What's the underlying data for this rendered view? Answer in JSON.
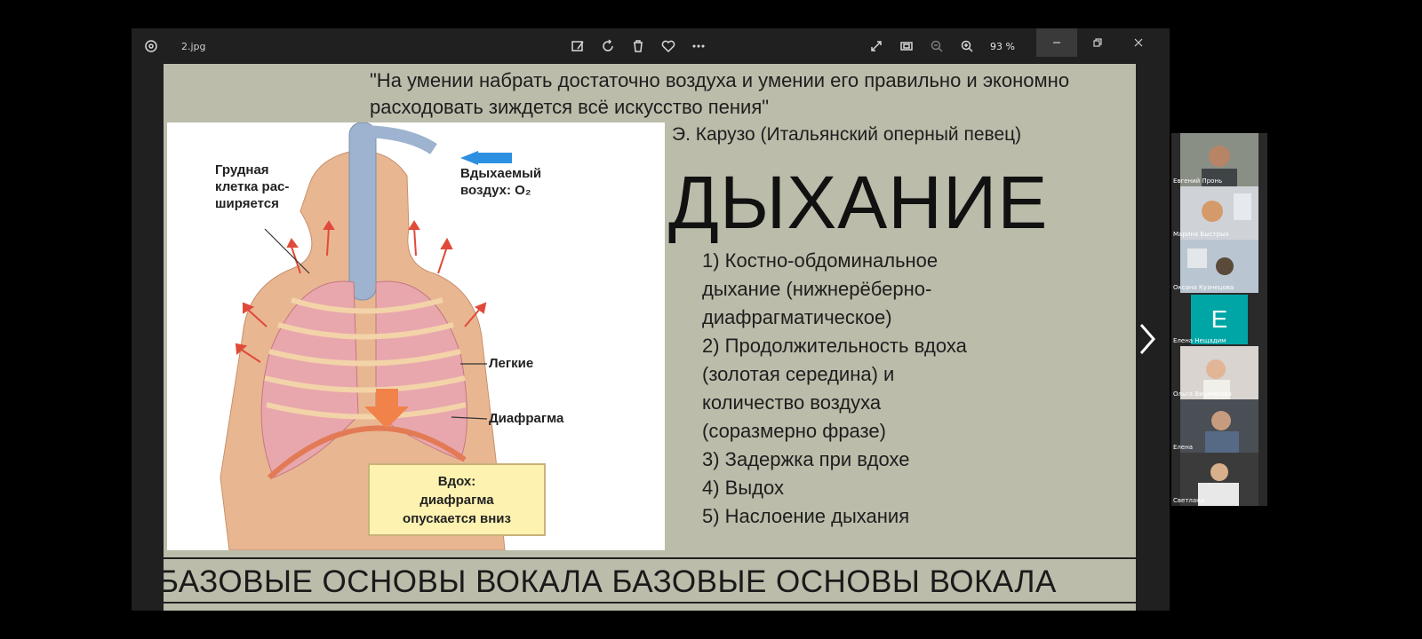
{
  "window": {
    "filename": "2.jpg",
    "zoom": "93 %",
    "toolbar_icons": [
      "edit-image-icon",
      "rotate-icon",
      "delete-icon",
      "favorite-icon",
      "more-icon"
    ],
    "right_icons": [
      "fullscreen-icon",
      "fit-icon",
      "zoom-out-icon",
      "zoom-in-icon"
    ]
  },
  "slide": {
    "quote": "\"На умении набрать достаточно воздуха и умении его правильно и экономно расходовать зиждется всё искусство пения\"",
    "author": "Э. Карузо (Итальянский оперный певец)",
    "heading": "ДЫХАНИЕ",
    "points": [
      "1) Костно-обдоминальное\nдыхание (нижнерёберно-\nдиафрагматическое)",
      "2) Продолжительность вдоха\n(золотая середина) и\nколичество воздуха\n(соразмерно фразе)",
      "3) Задержка при вдохе",
      "4) Выдох",
      "5) Наслоение дыхания"
    ],
    "illustration": {
      "label_chest": "Грудная\nклетка рас-\nширяется",
      "label_air": "Вдыхаемый\nвоздух: O₂",
      "label_lungs": "Легкие",
      "label_diaphragm": "Диафрагма",
      "callout": "Вдох:\nдиафрагма\nопускается вниз"
    },
    "footer": "БАЗОВЫЕ ОСНОВЫ ВОКАЛА  БАЗОВЫЕ ОСНОВЫ ВОКАЛА"
  },
  "participants": [
    {
      "name": "Евгений Пронь",
      "type": "video"
    },
    {
      "name": "Марина Быстрых",
      "type": "video"
    },
    {
      "name": "Оксана Кузнецова",
      "type": "video"
    },
    {
      "name": "Елена Нещадим",
      "type": "avatar",
      "initial": "E"
    },
    {
      "name": "Ольга Вишнякова",
      "type": "video"
    },
    {
      "name": "Елена",
      "type": "video"
    },
    {
      "name": "Светлана",
      "type": "video"
    }
  ]
}
